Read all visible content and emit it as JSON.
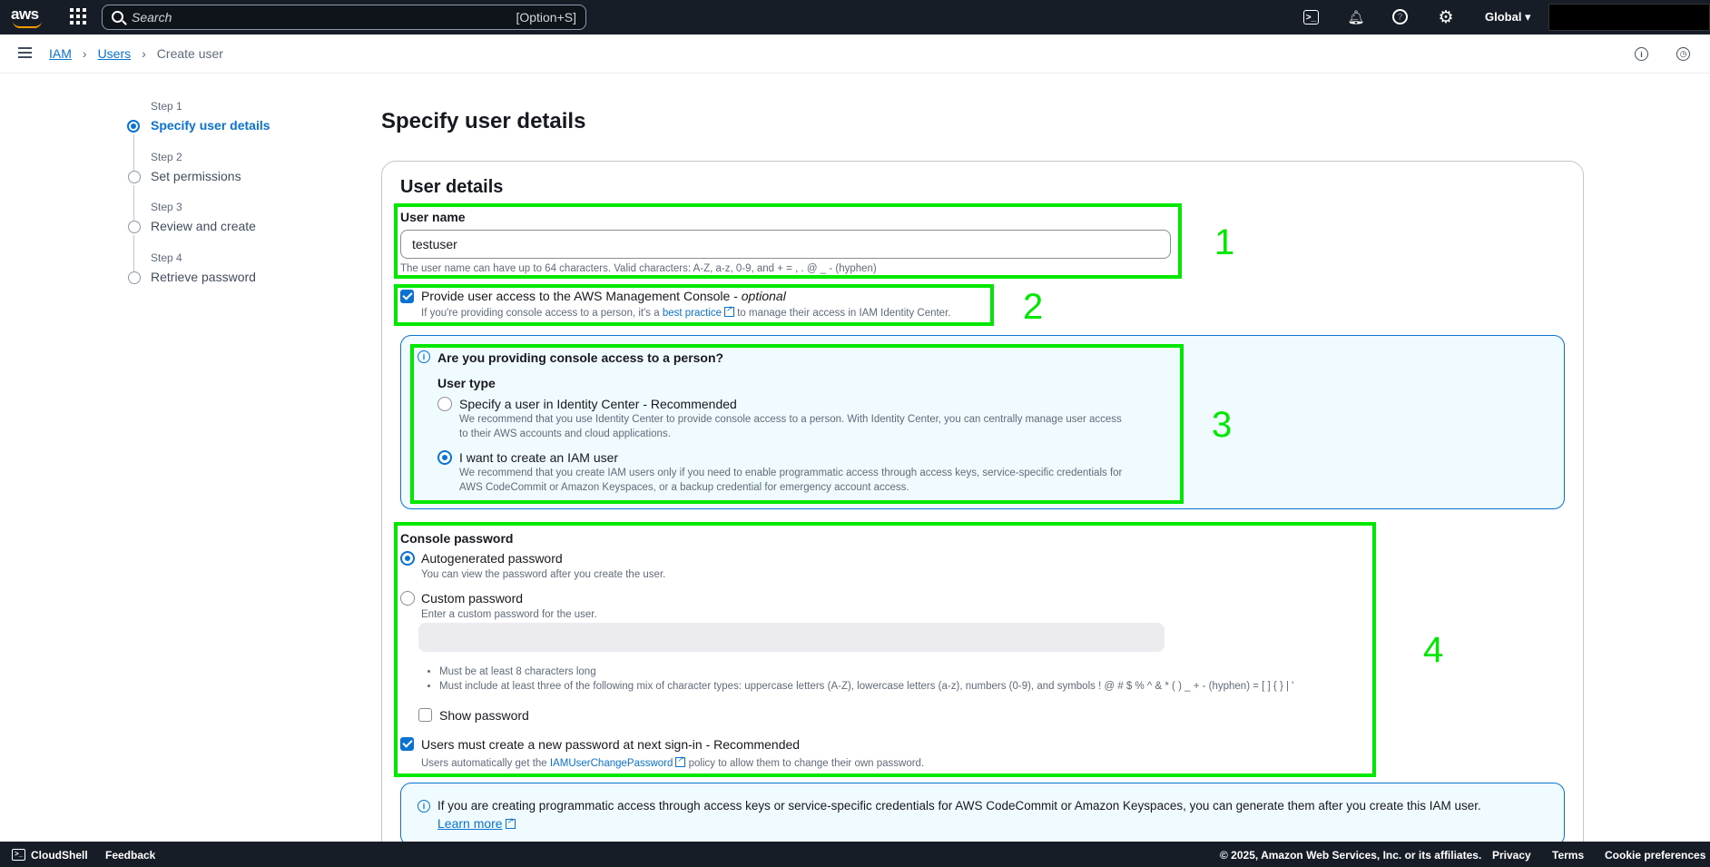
{
  "nav": {
    "logo": "aws",
    "search_placeholder": "Search",
    "search_shortcut": "[Option+S]",
    "region": "Global ▾",
    "icons": [
      "apps-icon",
      "cloudshell-icon",
      "bell-icon",
      "help-icon",
      "gear-icon"
    ]
  },
  "breadcrumb": {
    "items": [
      "IAM",
      "Users",
      "Create user"
    ]
  },
  "steps": [
    {
      "num": "Step 1",
      "title": "Specify user details"
    },
    {
      "num": "Step 2",
      "title": "Set permissions"
    },
    {
      "num": "Step 3",
      "title": "Review and create"
    },
    {
      "num": "Step 4",
      "title": "Retrieve password"
    }
  ],
  "page": {
    "title": "Specify user details",
    "card_title": "User details"
  },
  "username": {
    "label": "User name",
    "value": "testuser",
    "help": "The user name can have up to 64 characters. Valid characters: A-Z, a-z, 0-9, and + = , . @ _ - (hyphen)"
  },
  "console_access": {
    "label": "Provide user access to the AWS Management Console - ",
    "label_optional": "optional",
    "help_pre": "If you're providing console access to a person, it's a ",
    "help_link": "best practice",
    "help_post": " to manage their access in IAM Identity Center."
  },
  "person_panel": {
    "title": "Are you providing console access to a person?",
    "user_type_label": "User type",
    "opt1_label": "Specify a user in Identity Center - Recommended",
    "opt1_help_1": "We recommend that you use Identity Center to provide console access to a person. With Identity Center, you can centrally manage user access",
    "opt1_help_2": "to their AWS accounts and cloud applications.",
    "opt2_label": "I want to create an IAM user",
    "opt2_help_1": "We recommend that you create IAM users only if you need to enable programmatic access through access keys, service-specific credentials for",
    "opt2_help_2": "AWS CodeCommit or Amazon Keyspaces, or a backup credential for emergency account access."
  },
  "password": {
    "label": "Console password",
    "auto_label": "Autogenerated password",
    "auto_help": "You can view the password after you create the user.",
    "custom_label": "Custom password",
    "custom_help": "Enter a custom password for the user.",
    "rule_1": "Must be at least 8 characters long",
    "rule_2": "Must include at least three of the following mix of character types: uppercase letters (A-Z), lowercase letters (a-z), numbers (0-9), and symbols ! @ # $ % ^ & * ( ) _ + - (hyphen) = [ ] { } | '",
    "show_label": "Show password",
    "reset_label": "Users must create a new password at next sign-in - Recommended",
    "reset_help_pre": "Users automatically get the ",
    "reset_help_link": "IAMUserChangePassword",
    "reset_help_post": " policy to allow them to change their own password."
  },
  "programmatic_info": {
    "text": "If you are creating programmatic access through access keys or service-specific credentials for AWS CodeCommit or Amazon Keyspaces, you can generate them after you create this IAM user.",
    "link": "Learn more"
  },
  "annotations": [
    "1",
    "2",
    "3",
    "4"
  ],
  "footer": {
    "cloudshell": "CloudShell",
    "feedback": "Feedback",
    "copyright": "© 2025, Amazon Web Services, Inc. or its affiliates.",
    "privacy": "Privacy",
    "terms": "Terms",
    "cookies": "Cookie preferences"
  },
  "colors": {
    "accent": "#0972d3",
    "highlight": "#00e800",
    "nav_bg": "#161d26"
  }
}
